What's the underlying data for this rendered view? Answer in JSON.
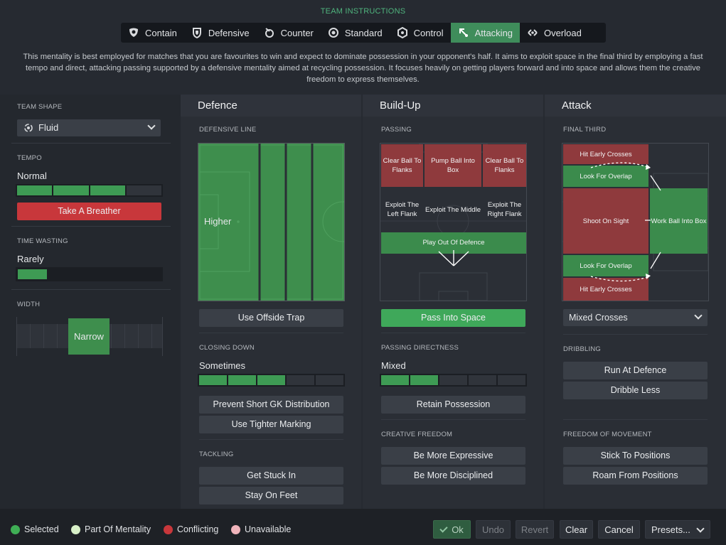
{
  "header": {
    "title": "TEAM INSTRUCTIONS"
  },
  "tabs": [
    {
      "label": "Contain",
      "icon": "shield-heart-icon"
    },
    {
      "label": "Defensive",
      "icon": "shield-icon"
    },
    {
      "label": "Counter",
      "icon": "counter-icon"
    },
    {
      "label": "Standard",
      "icon": "standard-icon"
    },
    {
      "label": "Control",
      "icon": "control-icon"
    },
    {
      "label": "Attacking",
      "icon": "attacking-icon",
      "active": true
    },
    {
      "label": "Overload",
      "icon": "overload-icon"
    }
  ],
  "description": "This mentality is best employed for matches that you are favourites to win and expect to dominate possession in your opponent's half. It aims to exploit space in the final third by employing a fast tempo and direct, attacking passing supported by a defensive mentality aimed at recycling possession. It focuses heavily on getting players forward and into space and allows them the creative freedom to express themselves.",
  "left": {
    "team_shape_label": "TEAM SHAPE",
    "team_shape_value": "Fluid",
    "tempo_label": "TEMPO",
    "tempo_value": "Normal",
    "tempo_level": 3,
    "tempo_steps": 4,
    "tempo_button": "Take A Breather",
    "time_wasting_label": "TIME WASTING",
    "time_wasting_value": "Rarely",
    "width_label": "WIDTH",
    "width_value": "Narrow"
  },
  "defence": {
    "title": "Defence",
    "defensive_line_label": "DEFENSIVE LINE",
    "defensive_line_value": "Higher",
    "offside_button": "Use Offside Trap",
    "closing_down_label": "CLOSING DOWN",
    "closing_down_value": "Sometimes",
    "closing_down_level": 3,
    "closing_down_steps": 5,
    "gk_button": "Prevent Short GK Distribution",
    "marking_button": "Use Tighter Marking",
    "tackling_label": "TACKLING",
    "tackle_button_1": "Get Stuck In",
    "tackle_button_2": "Stay On Feet"
  },
  "buildup": {
    "title": "Build-Up",
    "passing_label": "PASSING",
    "zones": {
      "clear_left": "Clear Ball To Flanks",
      "pump": "Pump Ball Into Box",
      "clear_right": "Clear Ball To Flanks",
      "exploit_left": "Exploit The Left Flank",
      "exploit_middle": "Exploit The Middle",
      "exploit_right": "Exploit The Right Flank",
      "play_out": "Play Out Of Defence"
    },
    "pass_space_button": "Pass Into Space",
    "directness_label": "PASSING DIRECTNESS",
    "directness_value": "Mixed",
    "directness_level": 2,
    "directness_steps": 5,
    "retain_button": "Retain Possession",
    "creative_label": "CREATIVE FREEDOM",
    "expressive_button": "Be More Expressive",
    "disciplined_button": "Be More Disciplined"
  },
  "attack": {
    "title": "Attack",
    "final_third_label": "FINAL THIRD",
    "zones": {
      "hit_early_top": "Hit Early Crosses",
      "overlap_top": "Look For Overlap",
      "shoot": "Shoot On Sight",
      "work_ball": "Work Ball Into Box",
      "overlap_bottom": "Look For Overlap",
      "hit_early_bottom": "Hit Early Crosses"
    },
    "crosses_value": "Mixed Crosses",
    "dribbling_label": "DRIBBLING",
    "run_button": "Run At Defence",
    "dribble_less_button": "Dribble Less",
    "freedom_label": "FREEDOM OF MOVEMENT",
    "stick_button": "Stick To Positions",
    "roam_button": "Roam From Positions"
  },
  "legend": [
    {
      "label": "Selected",
      "color": "#3fae55"
    },
    {
      "label": "Part Of Mentality",
      "color": "#d8f0c8"
    },
    {
      "label": "Conflicting",
      "color": "#c8373b"
    },
    {
      "label": "Unavailable",
      "color": "#f0b4bb"
    }
  ],
  "footer": {
    "ok": "Ok",
    "undo": "Undo",
    "revert": "Revert",
    "clear": "Clear",
    "cancel": "Cancel",
    "presets": "Presets..."
  }
}
